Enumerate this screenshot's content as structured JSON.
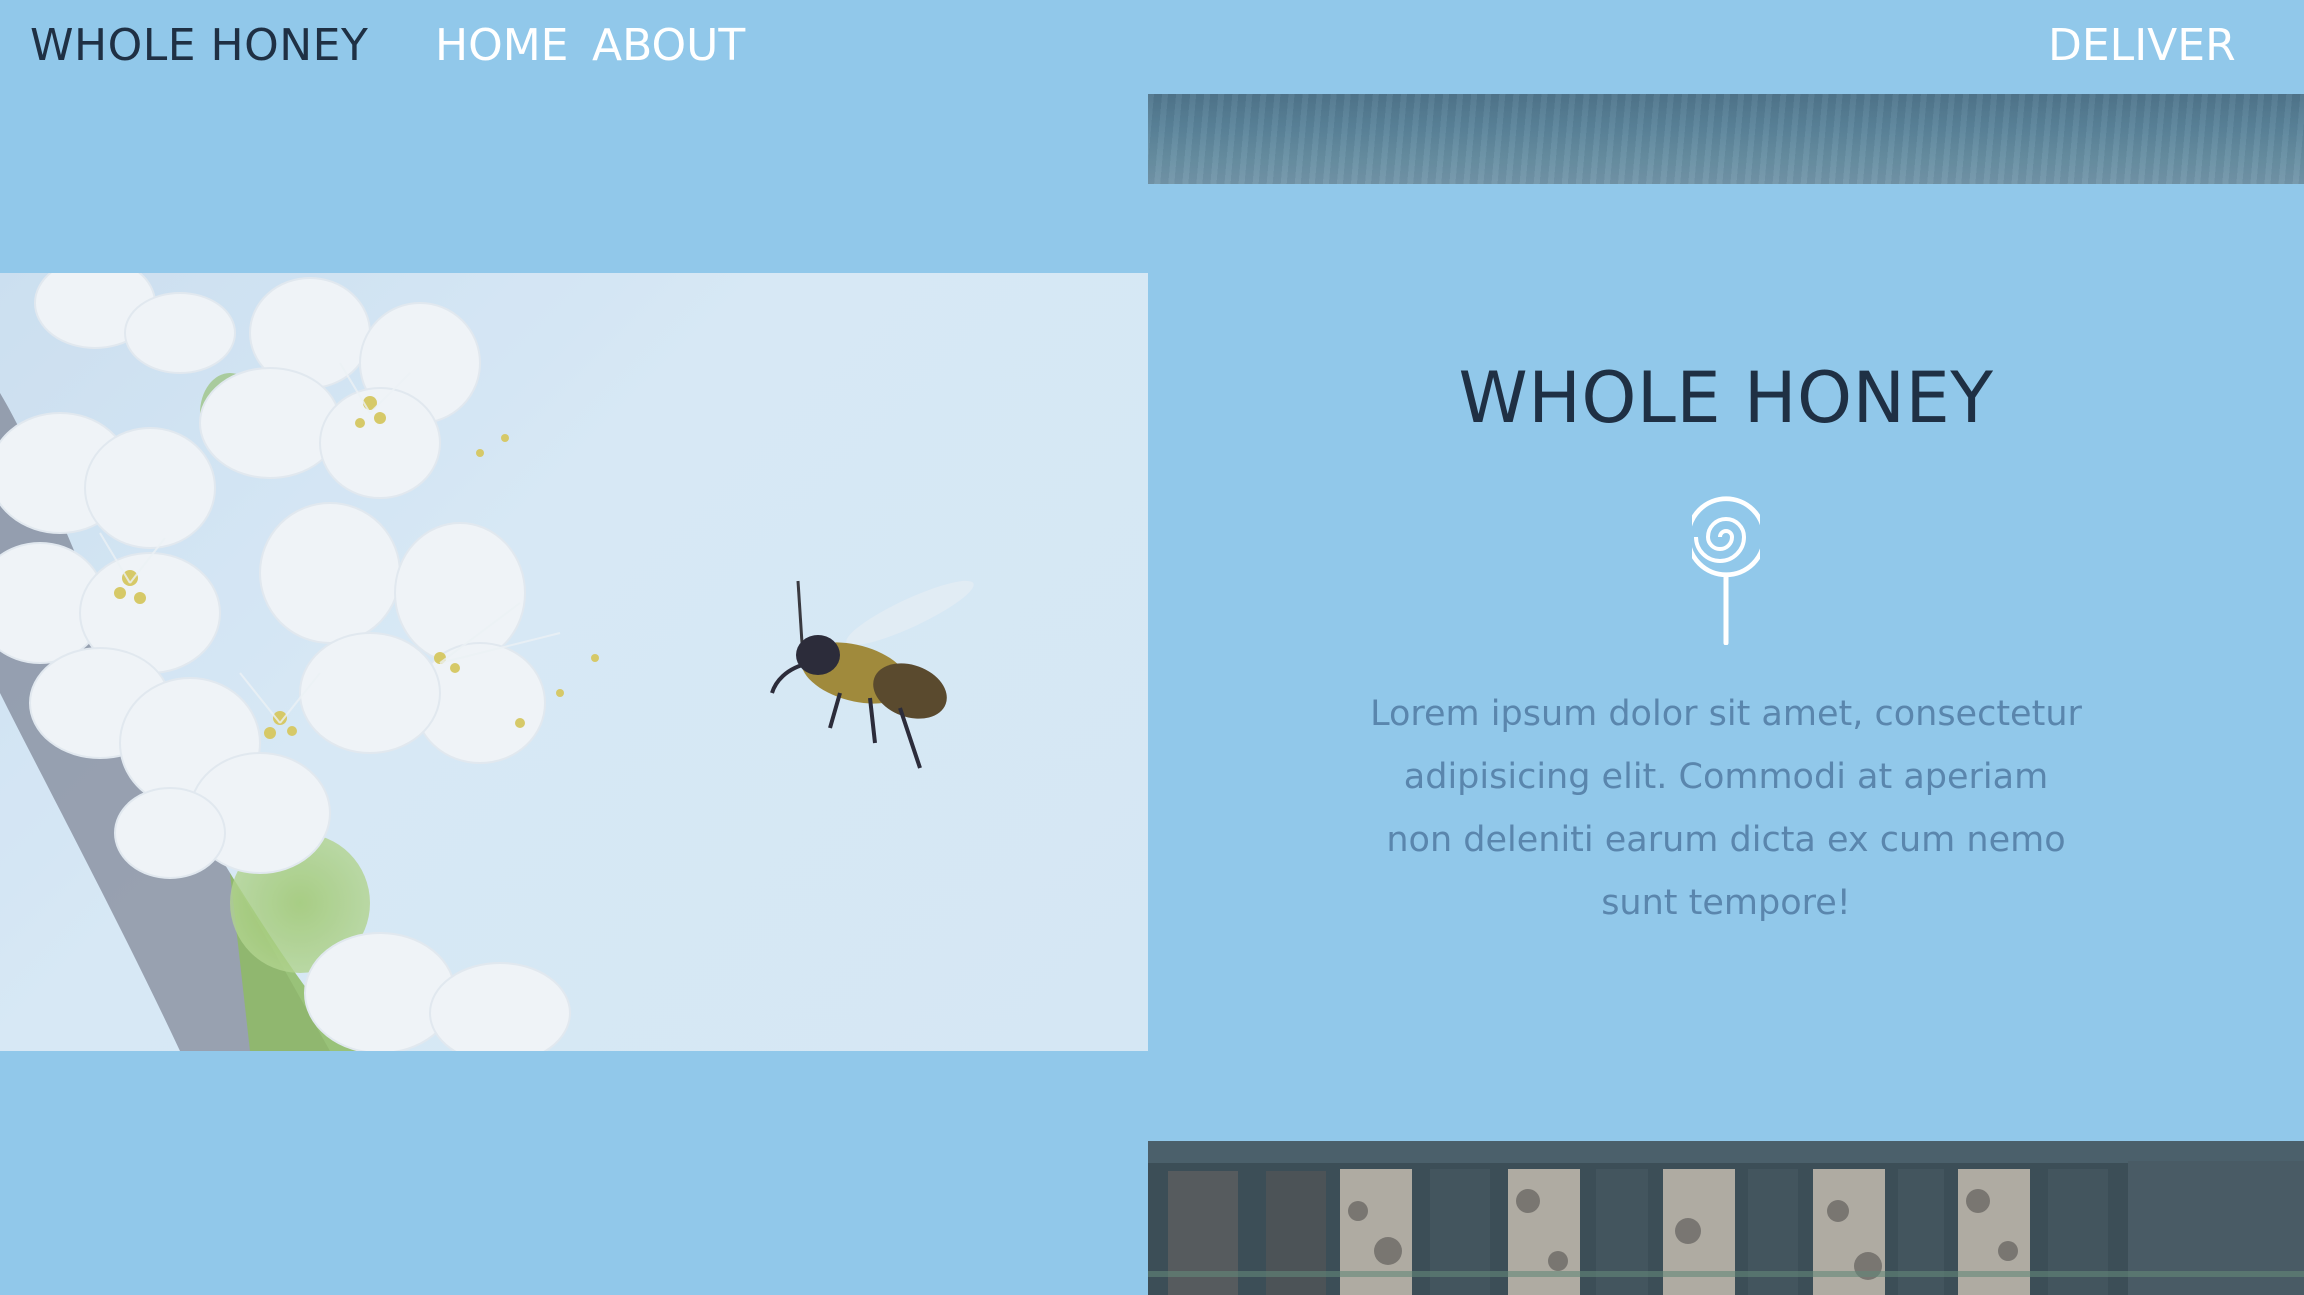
{
  "nav": {
    "brand": "WHOLE HONEY",
    "links": [
      {
        "label": "HOME"
      },
      {
        "label": "ABOUT"
      },
      {
        "label": "DELIVER"
      }
    ]
  },
  "hero": {
    "title": "WHOLE HONEY",
    "icon": "lollipop-icon",
    "text": "Lorem ipsum dolor sit amet, consectetur adipisicing elit. Commodi at aperiam non deleniti earum dicta ex cum nemo sunt tempore!"
  },
  "colors": {
    "background": "#91c8ea",
    "brand_text": "#1f3044",
    "nav_text": "#ffffff",
    "body_text": "#5a86ad"
  }
}
